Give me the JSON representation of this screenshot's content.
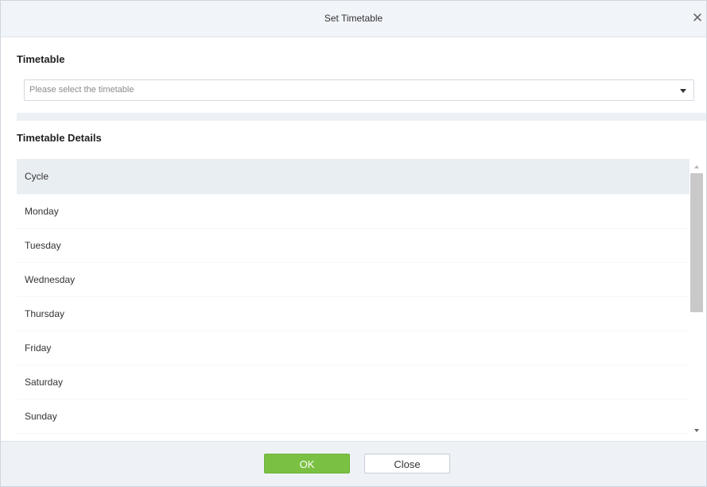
{
  "dialog": {
    "title": "Set Timetable",
    "close_icon": "close-icon"
  },
  "timetable": {
    "section_label": "Timetable",
    "placeholder": "Please select the timetable"
  },
  "details": {
    "section_label": "Timetable Details",
    "rows": [
      "Cycle",
      "Monday",
      "Tuesday",
      "Wednesday",
      "Thursday",
      "Friday",
      "Saturday",
      "Sunday"
    ]
  },
  "footer": {
    "ok_label": "OK",
    "close_label": "Close"
  },
  "colors": {
    "accent": "#7ac143",
    "header_bg": "#f1f4f8",
    "row_highlight": "#e9eef3"
  }
}
